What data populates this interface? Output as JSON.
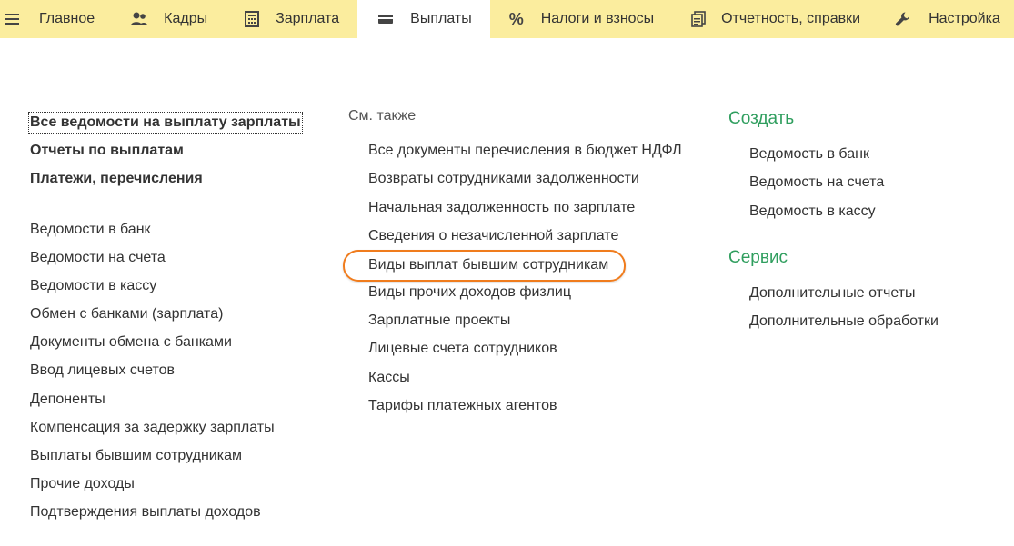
{
  "topbar": {
    "tabs": [
      {
        "label": "Главное",
        "icon": "main-icon"
      },
      {
        "label": "Кадры",
        "icon": "people-icon"
      },
      {
        "label": "Зарплата",
        "icon": "calculator-icon"
      },
      {
        "label": "Выплаты",
        "icon": "wallet-icon"
      },
      {
        "label": "Налоги и взносы",
        "icon": "percent-icon"
      },
      {
        "label": "Отчетность, справки",
        "icon": "reports-icon"
      },
      {
        "label": "Настройка",
        "icon": "wrench-icon"
      }
    ],
    "active_tab": "Выплаты"
  },
  "left": {
    "bold_items": [
      "Все ведомости на выплату зарплаты",
      "Отчеты по выплатам",
      "Платежи, перечисления"
    ],
    "items": [
      "Ведомости в банк",
      "Ведомости на счета",
      "Ведомости в кассу",
      "Обмен с банками (зарплата)",
      "Документы обмена с банками",
      "Ввод лицевых счетов",
      "Депоненты",
      "Компенсация за задержку зарплаты",
      "Выплаты бывшим сотрудникам",
      "Прочие доходы",
      "Подтверждения выплаты доходов"
    ]
  },
  "middle": {
    "header": "См. также",
    "items": [
      "Все документы перечисления в бюджет НДФЛ",
      "Возвраты сотрудниками задолженности",
      "Начальная задолженность по зарплате",
      "Сведения о незачисленной зарплате",
      "Виды выплат бывшим сотрудникам",
      "Виды прочих доходов физлиц",
      "Зарплатные проекты",
      "Лицевые счета сотрудников",
      "Кассы",
      "Тарифы платежных агентов"
    ]
  },
  "right": {
    "create": {
      "title": "Создать",
      "items": [
        "Ведомость в банк",
        "Ведомость на счета",
        "Ведомость в кассу"
      ]
    },
    "service": {
      "title": "Сервис",
      "items": [
        "Дополнительные отчеты",
        "Дополнительные обработки"
      ]
    }
  },
  "colors": {
    "topbar_bg": "#fbed9e",
    "section_title": "#2f9e5e",
    "highlight": "#f07c1d"
  }
}
